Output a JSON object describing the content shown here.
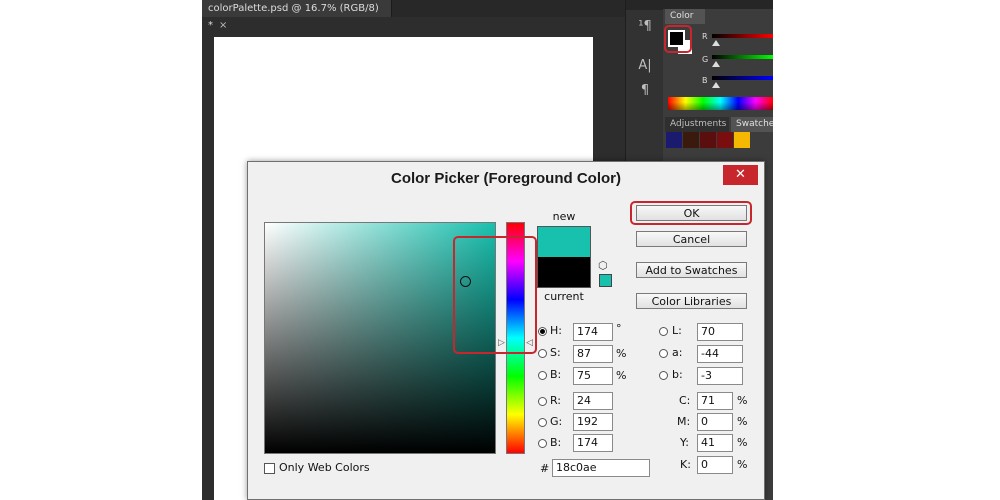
{
  "document": {
    "tab_title": "colorPalette.psd @ 16.7% (RGB/8) *",
    "close_glyph": "×"
  },
  "panels": {
    "color_tab": "Color",
    "adjustments_tab": "Adjustments",
    "swatches_tab": "Swatches",
    "slider_labels": [
      "R",
      "G",
      "B"
    ],
    "swatch_colors": [
      "#1a1a6e",
      "#3b1a0e",
      "#5a0e0e",
      "#7a0d0d",
      "#f5b800"
    ],
    "tools": [
      "paragraph-styles-icon",
      "character-icon",
      "paragraph-icon"
    ]
  },
  "dialog": {
    "title": "Color Picker (Foreground Color)",
    "close_glyph": "✕",
    "new_label": "new",
    "current_label": "current",
    "new_color": "#18c0ae",
    "current_color": "#000000",
    "buttons": {
      "ok": "OK",
      "cancel": "Cancel",
      "add_to_swatches": "Add to Swatches",
      "color_libraries": "Color Libraries"
    },
    "hsb": {
      "h": {
        "label": "H:",
        "value": "174",
        "unit": "°",
        "selected": true
      },
      "s": {
        "label": "S:",
        "value": "87",
        "unit": "%"
      },
      "b": {
        "label": "B:",
        "value": "75",
        "unit": "%"
      }
    },
    "rgb": {
      "r": {
        "label": "R:",
        "value": "24"
      },
      "g": {
        "label": "G:",
        "value": "192"
      },
      "b": {
        "label": "B:",
        "value": "174"
      }
    },
    "lab": {
      "l": {
        "label": "L:",
        "value": "70"
      },
      "a": {
        "label": "a:",
        "value": "-44"
      },
      "b": {
        "label": "b:",
        "value": "-3"
      }
    },
    "cmyk": {
      "c": {
        "label": "C:",
        "value": "71",
        "unit": "%"
      },
      "m": {
        "label": "M:",
        "value": "0",
        "unit": "%"
      },
      "y": {
        "label": "Y:",
        "value": "41",
        "unit": "%"
      },
      "k": {
        "label": "K:",
        "value": "0",
        "unit": "%"
      }
    },
    "hex_label": "#",
    "hex_value": "18c0ae",
    "only_web_colors": "Only Web Colors",
    "accent_highlight": "#c7272c"
  }
}
